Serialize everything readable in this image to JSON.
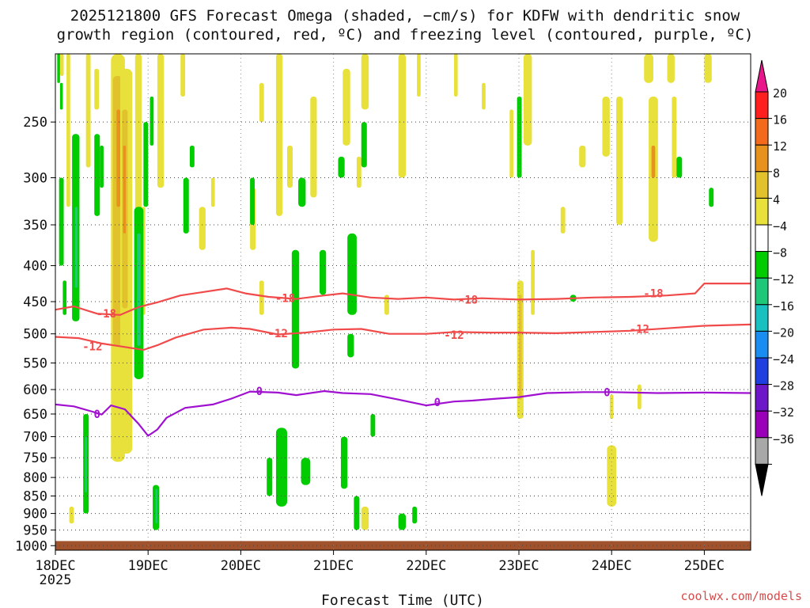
{
  "title": {
    "line1": "2025121800 GFS Forecast Omega (shaded, −cm/s) for KDFW with dendritic snow",
    "line2": "growth region (contoured, red, ºC) and freezing level (contoured, purple, ºC)"
  },
  "credit": "coolwx.com/models",
  "chart_data": {
    "type": "heatmap",
    "xlabel": "Forecast Time (UTC)",
    "ylabel": "",
    "x_tick_labels": [
      "18DEC",
      "19DEC",
      "20DEC",
      "21DEC",
      "22DEC",
      "23DEC",
      "24DEC",
      "25DEC"
    ],
    "x_tick_days": [
      0,
      1,
      2,
      3,
      4,
      5,
      6,
      7
    ],
    "x_sub_label": "2025",
    "x_range_days": [
      0,
      7.5
    ],
    "y_tick_labels": [
      "250",
      "300",
      "350",
      "400",
      "450",
      "500",
      "550",
      "600",
      "650",
      "700",
      "750",
      "800",
      "850",
      "900",
      "950",
      "1000"
    ],
    "y_range_hpa": [
      200,
      1015
    ],
    "y_scale": "log",
    "grid": true,
    "colorbar": {
      "labels": [
        "20",
        "16",
        "12",
        "8",
        "4",
        "−4",
        "−8",
        "−12",
        "−16",
        "−20",
        "−24",
        "−28",
        "−32",
        "−36"
      ],
      "colors": [
        "#ff1f1f",
        "#f36a1c",
        "#e8921e",
        "#e2c22c",
        "#e8e13c",
        "#ffffff",
        "#00cc00",
        "#1ec878",
        "#18c0c0",
        "#1a8ef0",
        "#1f3fe0",
        "#6d18c8",
        "#9a00b8",
        "#a8a8a8"
      ],
      "top_arrow_color": "#e8168a",
      "bottom_arrow_color": "#000000"
    },
    "series": [
      {
        "name": "-18",
        "color": "#f04a4a",
        "x": [
          0,
          0.2,
          0.45,
          0.7,
          0.9,
          1.1,
          1.35,
          1.6,
          1.85,
          2.05,
          2.3,
          2.6,
          2.9,
          3.1,
          3.4,
          3.7,
          4.0,
          4.3,
          4.6,
          5.0,
          5.4,
          5.8,
          6.2,
          6.6,
          6.9,
          7.0,
          7.2,
          7.5
        ],
        "y": [
          462,
          457,
          468,
          470,
          458,
          451,
          441,
          436,
          431,
          438,
          443,
          446,
          441,
          438,
          444,
          446,
          444,
          447,
          445,
          447,
          446,
          444,
          443,
          441,
          438,
          424,
          424,
          424
        ],
        "labels": [
          {
            "x": 0.55,
            "y": 468,
            "text": "-18"
          },
          {
            "x": 2.48,
            "y": 445,
            "text": "-18"
          },
          {
            "x": 4.45,
            "y": 447,
            "text": "-18"
          },
          {
            "x": 6.45,
            "y": 438,
            "text": "-18"
          }
        ]
      },
      {
        "name": "-12",
        "color": "#f04a4a",
        "x": [
          0,
          0.25,
          0.5,
          0.75,
          0.95,
          1.1,
          1.3,
          1.6,
          1.9,
          2.1,
          2.4,
          2.7,
          3.0,
          3.3,
          3.6,
          4.0,
          4.3,
          4.7,
          5.0,
          5.4,
          5.8,
          6.2,
          6.6,
          7.0,
          7.5
        ],
        "y": [
          505,
          507,
          516,
          522,
          527,
          519,
          506,
          493,
          490,
          492,
          501,
          498,
          493,
          492,
          500,
          500,
          497,
          498,
          498,
          499,
          497,
          495,
          491,
          487,
          485
        ],
        "labels": [
          {
            "x": 0.4,
            "y": 521,
            "text": "-12"
          },
          {
            "x": 2.4,
            "y": 499,
            "text": "-12"
          },
          {
            "x": 4.3,
            "y": 502,
            "text": "-12"
          },
          {
            "x": 6.3,
            "y": 492,
            "text": "-12"
          }
        ]
      },
      {
        "name": "0",
        "color": "#a010d0",
        "x": [
          0,
          0.2,
          0.4,
          0.5,
          0.6,
          0.75,
          0.9,
          1.0,
          1.1,
          1.2,
          1.4,
          1.7,
          1.9,
          2.1,
          2.4,
          2.6,
          2.9,
          3.1,
          3.4,
          3.7,
          4.0,
          4.3,
          4.5,
          4.7,
          5.0,
          5.3,
          5.7,
          6.0,
          6.5,
          7.0,
          7.5
        ],
        "y": [
          630,
          634,
          645,
          651,
          632,
          640,
          672,
          698,
          684,
          658,
          637,
          630,
          618,
          604,
          606,
          611,
          603,
          607,
          609,
          620,
          632,
          624,
          622,
          619,
          615,
          607,
          605,
          605,
          607,
          606,
          607
        ],
        "labels": [
          {
            "x": 0.45,
            "y": 650,
            "text": "0"
          },
          {
            "x": 2.2,
            "y": 603,
            "text": "0"
          },
          {
            "x": 4.12,
            "y": 625,
            "text": "0"
          },
          {
            "x": 5.95,
            "y": 605,
            "text": "0"
          }
        ]
      }
    ]
  }
}
